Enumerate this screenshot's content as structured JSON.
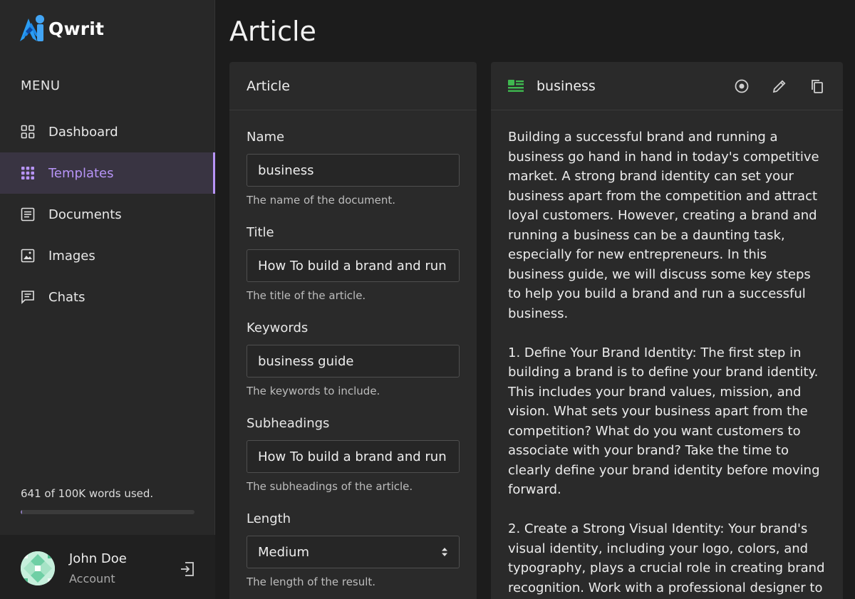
{
  "app": {
    "name": "Qwrit",
    "accent": "#b794f6"
  },
  "sidebar": {
    "menu_title": "MENU",
    "items": [
      {
        "label": "Dashboard",
        "icon": "dashboard-grid-icon",
        "active": false
      },
      {
        "label": "Templates",
        "icon": "dots-grid-icon",
        "active": true
      },
      {
        "label": "Documents",
        "icon": "document-list-icon",
        "active": false
      },
      {
        "label": "Images",
        "icon": "image-icon",
        "active": false
      },
      {
        "label": "Chats",
        "icon": "chat-icon",
        "active": false
      }
    ],
    "usage_text": "641 of 100K words used.",
    "usage_fraction": 0.0064,
    "account": {
      "name": "John Doe",
      "subtitle": "Account"
    }
  },
  "page": {
    "title": "Article"
  },
  "form": {
    "header": "Article",
    "fields": [
      {
        "label": "Name",
        "value": "business",
        "help": "The name of the document."
      },
      {
        "label": "Title",
        "value": "How To build a brand and run",
        "help": "The title of the article."
      },
      {
        "label": "Keywords",
        "value": "business guide",
        "help": "The keywords to include."
      },
      {
        "label": "Subheadings",
        "value": "How To build a brand and run",
        "help": "The subheadings of the article."
      },
      {
        "label": "Length",
        "value": "Medium",
        "help": "The length of the result.",
        "type": "select"
      }
    ]
  },
  "document": {
    "title": "business",
    "actions": [
      "view-icon",
      "edit-icon",
      "copy-icon"
    ],
    "paragraphs": [
      "Building a successful brand and running a business go hand in hand in today's competitive market. A strong brand identity can set your business apart from the competition and attract loyal customers. However, creating a brand and running a business can be a daunting task, especially for new entrepreneurs. In this business guide, we will discuss some key steps to help you build a brand and run a successful business.",
      "1. Define Your Brand Identity: The first step in building a brand is to define your brand identity. This includes your brand values, mission, and vision. What sets your business apart from the competition? What do you want customers to associate with your brand? Take the time to clearly define your brand identity before moving forward.",
      "2. Create a Strong Visual Identity: Your brand's visual identity, including your logo, colors, and typography, plays a crucial role in creating brand recognition. Work with a professional designer to"
    ]
  }
}
